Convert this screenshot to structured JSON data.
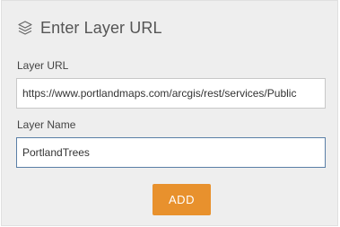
{
  "dialog": {
    "title": "Enter Layer URL",
    "title_icon": "layers-icon",
    "url_label": "Layer URL",
    "url_value": "https://www.portlandmaps.com/arcgis/rest/services/Public",
    "name_label": "Layer Name",
    "name_value": "PortlandTrees",
    "add_label": "ADD"
  },
  "colors": {
    "accent": "#e8912d",
    "focus_border": "#5a7fa6",
    "panel_bg": "#eeeeee"
  }
}
